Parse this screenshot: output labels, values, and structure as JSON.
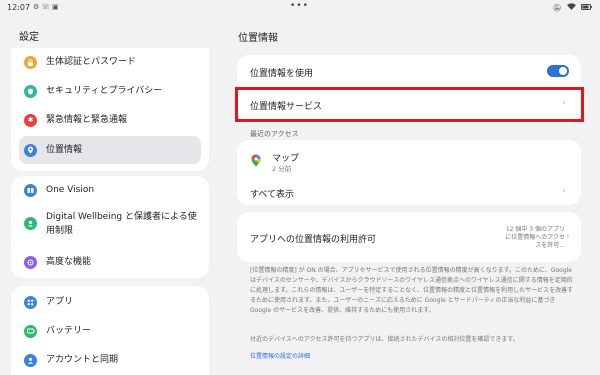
{
  "status_bar": {
    "time": "12:07",
    "left_icons": [
      "settings-status-icon",
      "phone-status-icon",
      "image-status-icon"
    ],
    "center_dots": "•••",
    "right_icons": [
      "mute-icon",
      "wifi-icon",
      "battery-icon"
    ]
  },
  "sidebar": {
    "title": "設定",
    "groups": [
      [
        {
          "label": "生体認証とパスワード",
          "icon": "lock-icon",
          "color": "#f2a53a"
        },
        {
          "label": "セキュリティとプライバシー",
          "icon": "shield-icon",
          "color": "#2fb89a"
        },
        {
          "label": "緊急情報と緊急通報",
          "icon": "emergency-icon",
          "color": "#ec3e43"
        },
        {
          "label": "位置情報",
          "icon": "location-icon",
          "color": "#3b82e0",
          "selected": true
        }
      ],
      [
        {
          "label": "One Vision",
          "icon": "one-vision-icon",
          "color": "#3b82e0"
        },
        {
          "label": "Digital Wellbeing と保護者による使用制限",
          "icon": "wellbeing-icon",
          "color": "#2eb872"
        },
        {
          "label": "高度な機能",
          "icon": "advanced-icon",
          "color": "#8b5cf6"
        }
      ],
      [
        {
          "label": "アプリ",
          "icon": "apps-icon",
          "color": "#3b82e0"
        },
        {
          "label": "バッテリー",
          "icon": "battery-setting-icon",
          "color": "#2eb872"
        },
        {
          "label": "アカウントと同期",
          "icon": "account-icon",
          "color": "#3b82e0"
        }
      ]
    ]
  },
  "main": {
    "title": "位置情報",
    "use_location_label": "位置情報を使用",
    "use_location_on": true,
    "location_services_label": "位置情報サービス",
    "recent_section_label": "最近のアクセス",
    "recent_app_name": "マップ",
    "recent_app_time": "2 分前",
    "show_all_label": "すべて表示",
    "app_permission_label": "アプリへの位置情報の利用許可",
    "app_permission_summary": "12 個中 3 個のアプリに位置情報へのアクセスを許可...",
    "footer_paragraph_1": "[位置情報の精度] が ON の場合、アプリやサービスで使用される位置情報の精度が高くなります。このために、Google はデバイスのセンサーや、デバイスからクラウドソースのワイヤレス通信拠点へのワイヤレス通信に関する情報を定期的に処理します。これらの情報は、ユーザーを特定することなく、位置情報の精度と位置情報を利用したサービスを改善するために使用されます。また、ユーザーのニーズに応えるために Google とサードパーティの正当な利益に基づき Google のサービスを改善、提供、維持するためにも使用されます。",
    "footer_paragraph_2": "付近のデバイスへのアクセス許可を持つアプリは、接続されたデバイスの相対位置を確認できます。",
    "footer_link": "位置情報の設定の詳細"
  },
  "colors": {
    "accent": "#2f6fd6",
    "highlight": "#e0161b",
    "background": "#f2f2f4"
  }
}
